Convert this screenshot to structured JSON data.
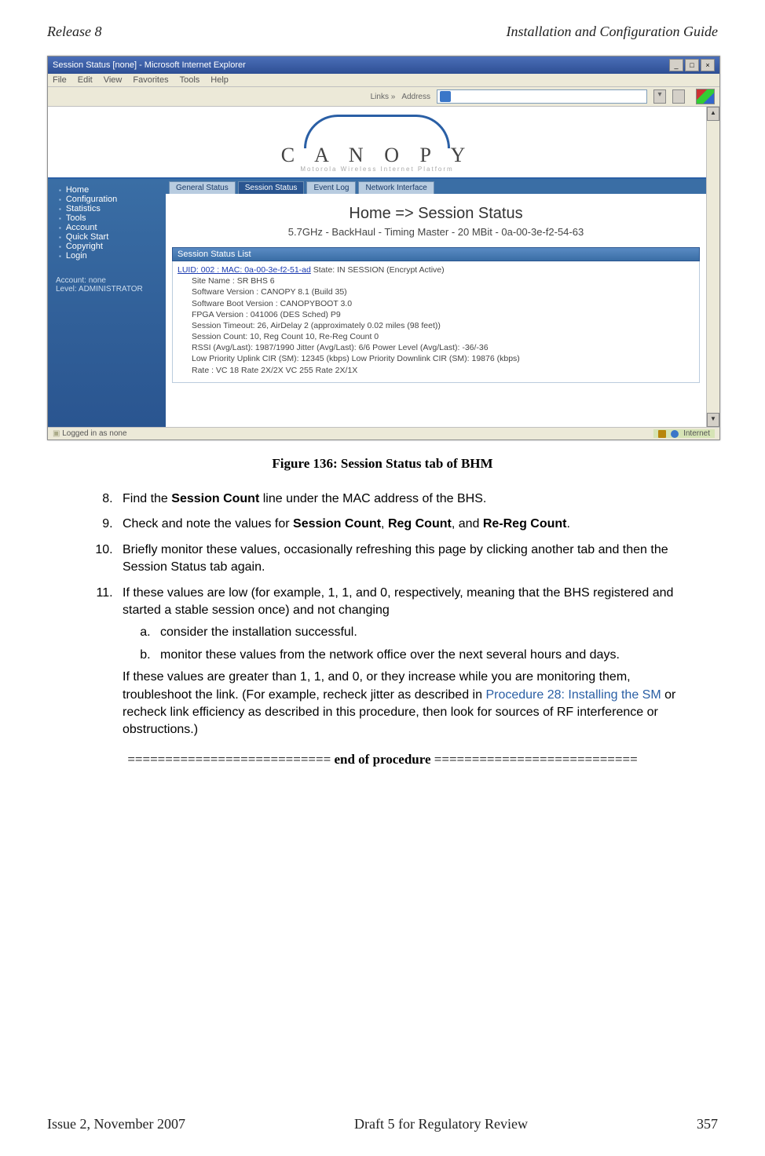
{
  "header": {
    "left": "Release 8",
    "right": "Installation and Configuration Guide"
  },
  "footer": {
    "left": "Issue 2, November 2007",
    "center": "Draft 5 for Regulatory Review",
    "right": "357"
  },
  "browser": {
    "title": "Session Status [none] - Microsoft Internet Explorer",
    "menu": [
      "File",
      "Edit",
      "View",
      "Favorites",
      "Tools",
      "Help"
    ],
    "links_label": "Links »",
    "address_label": "Address",
    "status_left": "Logged in as none",
    "status_right": "Internet"
  },
  "canopy": {
    "brand": "C A N O P Y",
    "tagline": "Motorola Wireless Internet Platform",
    "sidebar": [
      "Home",
      "Configuration",
      "Statistics",
      "Tools",
      "Account",
      "Quick Start",
      "Copyright",
      "Login"
    ],
    "account_line1": "Account: none",
    "account_line2": "Level: ADMINISTRATOR",
    "tabs": [
      "General Status",
      "Session Status",
      "Event Log",
      "Network Interface"
    ],
    "active_tab_index": 1,
    "page_title": "Home => Session Status",
    "page_subtitle": "5.7GHz - BackHaul - Timing Master - 20 MBit - 0a-00-3e-f2-54-63",
    "panel_title": "Session Status List",
    "luid_link": "LUID: 002 : MAC: 0a-00-3e-f2-51-ad",
    "luid_state": " State: IN SESSION (Encrypt Active)",
    "lines": [
      "Site Name : SR BHS 6",
      "Software Version : CANOPY 8.1 (Build 35)",
      "Software Boot Version : CANOPYBOOT 3.0",
      "FPGA Version : 041006 (DES Sched) P9",
      "Session Timeout: 26, AirDelay 2 (approximately 0.02 miles (98 feet))",
      "Session Count: 10, Reg Count 10, Re-Reg Count 0",
      "RSSI (Avg/Last): 1987/1990   Jitter (Avg/Last): 6/6   Power Level (Avg/Last): -36/-36",
      "Low Priority Uplink CIR (SM): 12345 (kbps) Low Priority Downlink CIR (SM): 19876 (kbps)",
      "Rate : VC 18 Rate 2X/2X       VC 255 Rate 2X/1X"
    ]
  },
  "caption": "Figure 136: Session Status tab of BHM",
  "steps": {
    "s8_a": "Find the ",
    "s8_b": "Session Count",
    "s8_c": " line under the MAC address of the BHS.",
    "s9_a": "Check and note the values for ",
    "s9_b": "Session Count",
    "s9_c": ", ",
    "s9_d": "Reg Count",
    "s9_e": ", and ",
    "s9_f": "Re-Reg Count",
    "s9_g": ".",
    "s10": "Briefly monitor these values, occasionally refreshing this page by clicking another tab and then the Session Status tab again.",
    "s11_intro": "If these values are low (for example, 1, 1, and 0, respectively, meaning that the BHS registered and started a stable session once) and not changing",
    "s11_a": "consider the installation successful.",
    "s11_b": "monitor these values from the network office over the next several hours and days.",
    "s11_after_a": "If these values are greater than 1, 1, and 0, or they increase while you are monitoring them, troubleshoot the link. (For example, recheck jitter as described in ",
    "s11_link": "Procedure 28: Installing the SM",
    "s11_after_b": " or recheck link efficiency as described in this procedure, then look for sources of RF interference or obstructions.)"
  },
  "eop": {
    "left": "=========================== ",
    "mid": "end of procedure",
    "right": " ==========================="
  }
}
